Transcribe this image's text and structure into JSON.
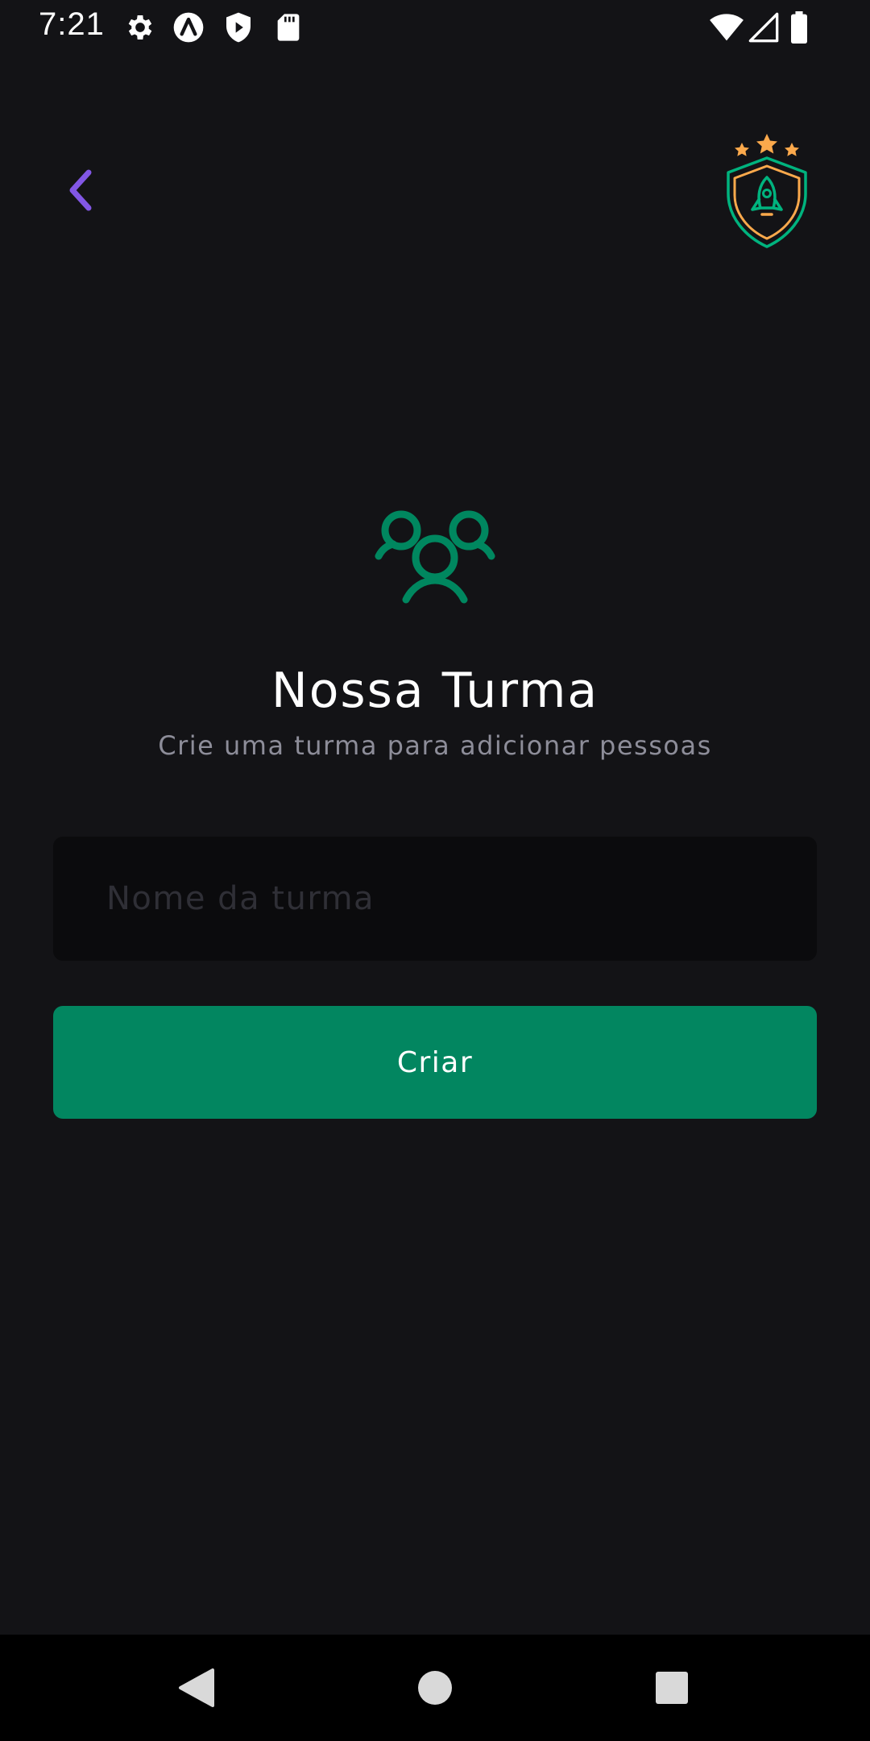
{
  "status_bar": {
    "time": "7:21",
    "left_icons": [
      "settings-icon",
      "app-a-icon",
      "shield-play-icon",
      "sd-card-icon"
    ],
    "right_icons": [
      "wifi-icon",
      "signal-icon",
      "battery-icon"
    ]
  },
  "header": {
    "back_icon": "chevron-left-icon",
    "logo_icon": "rocket-shield-logo"
  },
  "main": {
    "icon": "users-group-icon",
    "title": "Nossa Turma",
    "subtitle": "Crie uma turma para adicionar pessoas",
    "input": {
      "placeholder": "Nome da turma",
      "value": ""
    },
    "create_button_label": "Criar"
  },
  "colors": {
    "background": "#131316",
    "accent_green": "#028660",
    "back_arrow": "#8257e5",
    "logo_star": "#fba94c",
    "input_bg": "#0b0b0d",
    "subtitle": "#8d8d99"
  },
  "nav_bar": {
    "buttons": [
      "back-triangle-icon",
      "home-circle-icon",
      "recents-square-icon"
    ]
  }
}
